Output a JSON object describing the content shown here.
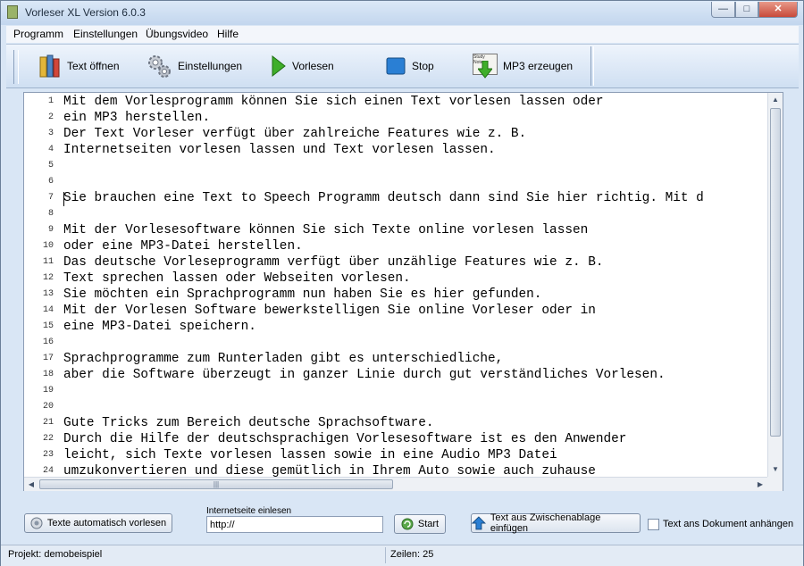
{
  "window": {
    "title": "Vorleser XL Version 6.0.3",
    "minimize": "—",
    "maximize": "□",
    "close": "✕"
  },
  "menu": [
    "Programm",
    "Einstellungen",
    "Übungsvideo",
    "Hilfe"
  ],
  "toolbar": {
    "open_label": "Text öffnen",
    "settings_label": "Einstellungen",
    "read_label": "Vorlesen",
    "stop_label": "Stop",
    "mp3_label": "MP3 erzeugen",
    "mp3_icon_text": "Study Notes"
  },
  "editor": {
    "line_numbers": [
      "1",
      "2",
      "3",
      "4",
      "5",
      "6",
      "7",
      "8",
      "9",
      "10",
      "11",
      "12",
      "13",
      "14",
      "15",
      "16",
      "17",
      "18",
      "19",
      "20",
      "21",
      "22",
      "23",
      "24"
    ],
    "lines": [
      "Mit dem Vorlesprogramm können Sie sich einen Text vorlesen lassen oder",
      "ein MP3 herstellen.",
      "Der Text Vorleser verfügt über zahlreiche Features wie z. B.",
      "Internetseiten vorlesen lassen und Text vorlesen lassen.",
      "",
      "",
      "Sie brauchen eine Text to Speech Programm deutsch dann sind Sie hier richtig. Mit d",
      "",
      "Mit der Vorlesesoftware können Sie sich Texte online vorlesen lassen",
      "oder eine MP3-Datei herstellen.",
      "Das deutsche Vorleseprogramm verfügt über unzählige Features wie z. B.",
      "Text sprechen lassen oder Webseiten vorlesen.",
      "Sie möchten ein Sprachprogramm nun haben Sie es hier gefunden.",
      "Mit der Vorlesen Software bewerkstelligen Sie online Vorleser oder in",
      "eine MP3-Datei speichern.",
      "",
      "Sprachprogramme zum Runterladen gibt es unterschiedliche,",
      "aber die Software überzeugt in ganzer Linie durch gut verständliches Vorlesen.",
      "",
      "",
      "Gute Tricks zum Bereich deutsche Sprachsoftware.",
      "Durch die Hilfe der deutschsprachigen Vorlesesoftware ist es den Anwender",
      "leicht, sich Texte vorlesen lassen sowie in eine Audio MP3 Datei",
      "umzukonvertieren und diese gemütlich in Ihrem Auto sowie auch zuhause"
    ]
  },
  "bottom": {
    "auto_read_label": "Texte automatisch vorlesen",
    "url_label": "Internetseite einlesen",
    "url_value": "http://",
    "start_label": "Start",
    "clipboard_label": "Text aus Zwischenablage einfügen",
    "append_label": "Text ans Dokument anhängen",
    "append_checked": false
  },
  "status": {
    "project": "Projekt: demobeispiel",
    "lines": "Zeilen: 25"
  },
  "colors": {
    "accent": "#3a7bd5",
    "toolbar": "#dbe7f6",
    "stop": "#2a7fd4",
    "play": "#3fae2a"
  }
}
